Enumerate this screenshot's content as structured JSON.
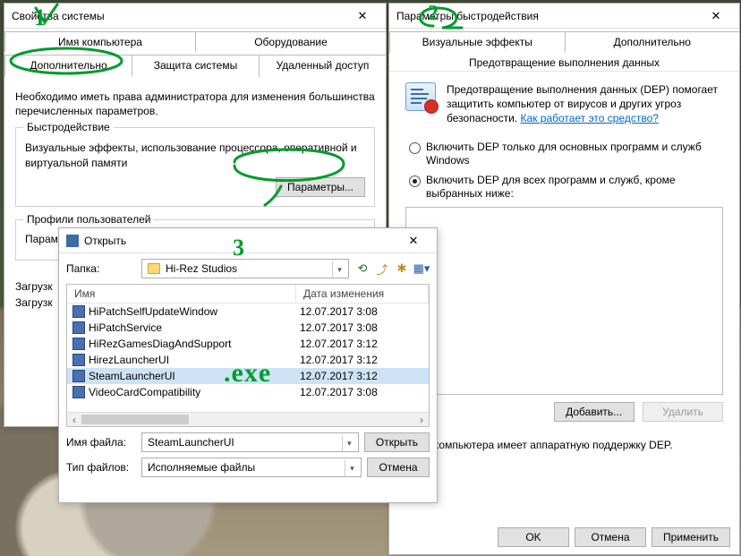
{
  "win1": {
    "title": "Свойства системы",
    "tabs_row1": [
      "Имя компьютера",
      "Оборудование"
    ],
    "tabs_row2": [
      "Дополнительно",
      "Защита системы",
      "Удаленный доступ"
    ],
    "active_tab": "Дополнительно",
    "intro": "Необходимо иметь права администратора для изменения большинства перечисленных параметров.",
    "perf": {
      "group": "Быстродействие",
      "desc": "Визуальные эффекты, использование процессора, оперативной и виртуальной памяти",
      "btn": "Параметры..."
    },
    "profiles": {
      "group": "Профили пользователей",
      "desc": "Параметры рабочего стола, относящиеся ко входу в систему"
    },
    "startup": {
      "line1": "Загрузк",
      "line2": "Загрузк"
    }
  },
  "win2": {
    "title": "Параметры быстродействия",
    "tabs": [
      "Визуальные эффекты",
      "Дополнительно"
    ],
    "sub_tab": "Предотвращение выполнения данных",
    "desc": "Предотвращение выполнения данных (DEP) помогает защитить компьютер от вирусов и других угроз безопасности.",
    "link": "Как работает это средство?",
    "opt1": "Включить DEP только для основных программ и служб Windows",
    "opt2": "Включить DEP для всех программ и служб, кроме выбранных ниже:",
    "add": "Добавить...",
    "remove": "Удалить",
    "note_suffix": "этого компьютера имеет аппаратную поддержку DEP.",
    "ok": "OK",
    "cancel": "Отмена",
    "apply": "Применить"
  },
  "win3": {
    "title": "Открыть",
    "folder_label": "Папка:",
    "folder": "Hi-Rez Studios",
    "hdr_name": "Имя",
    "hdr_date": "Дата изменения",
    "files": [
      {
        "name": "HiPatchSelfUpdateWindow",
        "date": "12.07.2017 3:08"
      },
      {
        "name": "HiPatchService",
        "date": "12.07.2017 3:08"
      },
      {
        "name": "HiRezGamesDiagAndSupport",
        "date": "12.07.2017 3:12"
      },
      {
        "name": "HirezLauncherUI",
        "date": "12.07.2017 3:12"
      },
      {
        "name": "SteamLauncherUI",
        "date": "12.07.2017 3:12"
      },
      {
        "name": "VideoCardCompatibility",
        "date": "12.07.2017 3:08"
      }
    ],
    "selected_index": 4,
    "filename_label": "Имя файла:",
    "filename": "SteamLauncherUI",
    "type_label": "Тип файлов:",
    "type": "Исполняемые файлы",
    "open": "Открыть",
    "cancel": "Отмена"
  },
  "annotations": {
    "n1": "1",
    "n2": "2",
    "n3": "3",
    "exe": ".exe"
  }
}
